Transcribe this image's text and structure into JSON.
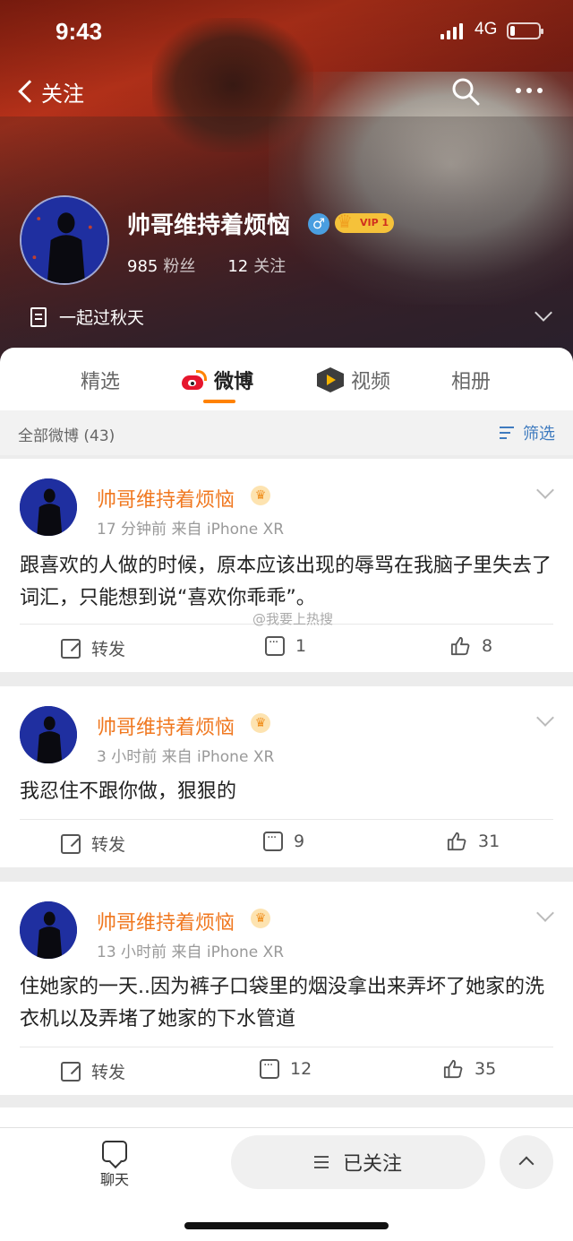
{
  "status_bar": {
    "time": "9:43",
    "network": "4G"
  },
  "nav": {
    "back_label": "关注"
  },
  "profile": {
    "name": "帅哥维持着烦恼",
    "gender_symbol": "♂",
    "vip_label": "VIP 1",
    "followers_count": "985",
    "followers_label": "粉丝",
    "following_count": "12",
    "following_label": "关注",
    "bio": "一起过秋天"
  },
  "tabs": [
    {
      "label": "精选"
    },
    {
      "label": "微博"
    },
    {
      "label": "视频"
    },
    {
      "label": "相册"
    }
  ],
  "filter": {
    "label": "全部微博 (43)",
    "button": "筛选"
  },
  "posts": [
    {
      "author": "帅哥维持着烦恼",
      "meta": "17 分钟前   来自 iPhone XR",
      "text": "跟喜欢的人做的时候，原本应该出现的辱骂在我脑子里失去了词汇，只能想到说“喜欢你乖乖”。",
      "forward_label": "转发",
      "comments": "1",
      "likes": "8"
    },
    {
      "author": "帅哥维持着烦恼",
      "meta": "3 小时前   来自 iPhone XR",
      "text": "我忍住不跟你做，狠狠的",
      "forward_label": "转发",
      "comments": "9",
      "likes": "31"
    },
    {
      "author": "帅哥维持着烦恼",
      "meta": "13 小时前   来自 iPhone XR",
      "text": "住她家的一天..因为裤子口袋里的烟没拿出来弄坏了她家的洗衣机以及弄堵了她家的下水管道",
      "forward_label": "转发",
      "comments": "12",
      "likes": "35"
    }
  ],
  "watermark": "@我要上热搜",
  "bottom_bar": {
    "chat_label": "聊天",
    "follow_label": "已关注"
  },
  "colors": {
    "accent": "#ff8200",
    "name_orange": "#f07820",
    "link_blue": "#3f7bbf"
  }
}
